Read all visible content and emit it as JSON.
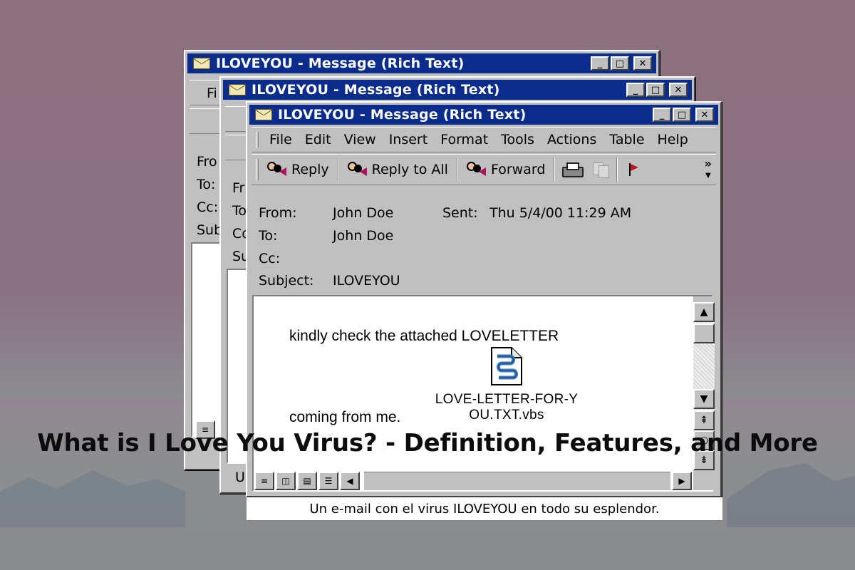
{
  "article": {
    "headline": "What is I Love You Virus? - Definition, Features, and More",
    "caption": "Un e-mail con el virus ILOVEYOU en todo su esplendor."
  },
  "window": {
    "title": "ILOVEYOU - Message (Rich Text)",
    "controls": {
      "minimize": "_",
      "maximize": "□",
      "close": "✕"
    }
  },
  "back_windows": {
    "menu_fragment": "Fi",
    "labels_a": [
      "Fro",
      "To:",
      "Cc:",
      "Sub"
    ],
    "labels_b": [
      "Fr",
      "To",
      "Co",
      "Su"
    ],
    "status_fragment": "U"
  },
  "menubar": {
    "items": [
      "File",
      "Edit",
      "View",
      "Insert",
      "Format",
      "Tools",
      "Actions",
      "Table",
      "Help"
    ]
  },
  "toolbar": {
    "reply": "Reply",
    "reply_all": "Reply to All",
    "forward": "Forward",
    "more": "»"
  },
  "header": {
    "from_label": "From:",
    "from_value": "John Doe",
    "sent_label": "Sent:",
    "sent_value": "Thu 5/4/00 11:29 AM",
    "to_label": "To:",
    "to_value": "John Doe",
    "cc_label": "Cc:",
    "cc_value": "",
    "subject_label": "Subject:",
    "subject_value": "ILOVEYOU"
  },
  "message": {
    "line1": "kindly check the attached LOVELETTER",
    "line2": "coming from me.",
    "attachment": {
      "name_line1": "LOVE-LETTER-FOR-Y",
      "name_line2": "OU.TXT.vbs",
      "icon": "script-file-icon"
    }
  },
  "scrollbar": {
    "up": "▲",
    "down": "▼",
    "prev_page": "⇞",
    "next_page": "⇟",
    "browse": "○"
  },
  "statusbar": {
    "left": "◀",
    "right": "▶"
  }
}
